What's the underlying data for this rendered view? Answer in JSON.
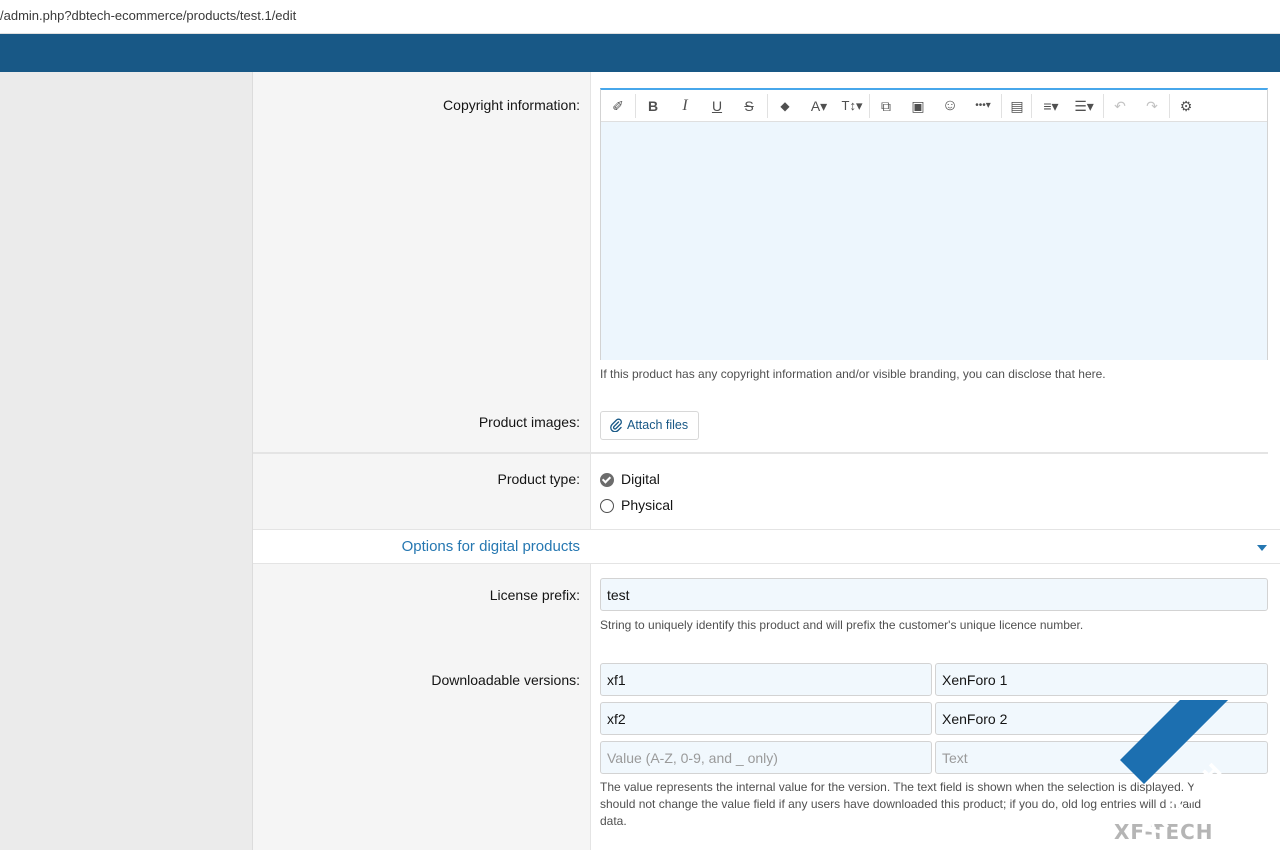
{
  "browser": {
    "url": "/admin.php?dbtech-ecommerce/products/test.1/edit"
  },
  "copyright": {
    "label": "Copyright information:",
    "hint": "If this product has any copyright information and/or visible branding, you can disclose that here.",
    "toolbar": {
      "remove_format": "✐",
      "bold": "B",
      "italic": "I",
      "underline": "U",
      "strike": "S",
      "color": "◆",
      "font_family": "A▾",
      "font_size": "T↕▾",
      "link": "⧉",
      "image": "▣",
      "smilie": "☺",
      "more": "•••▾",
      "media": "▤",
      "align": "≡▾",
      "list": "☰▾",
      "undo": "↶",
      "redo": "↷",
      "settings": "⚙"
    }
  },
  "images": {
    "label": "Product images:",
    "attach_label": "Attach files"
  },
  "product_type": {
    "label": "Product type:",
    "options": [
      {
        "label": "Digital",
        "selected": true
      },
      {
        "label": "Physical",
        "selected": false
      }
    ]
  },
  "digital_section": {
    "title": "Options for digital products"
  },
  "license": {
    "label": "License prefix:",
    "value": "test",
    "hint": "String to uniquely identify this product and will prefix the customer's unique licence number."
  },
  "versions": {
    "label": "Downloadable versions:",
    "rows": [
      {
        "value": "xf1",
        "text": "XenForo 1"
      },
      {
        "value": "xf2",
        "text": "XenForo 2"
      }
    ],
    "value_placeholder": "Value (A-Z, 0-9, and _ only)",
    "text_placeholder": "Text",
    "hint_lines": [
      "The value represents the internal value for the version. The text field is shown when the selection is displayed. Y",
      "should not change the value field if any users have downloaded this product; if you do, old log entries will d    nvalid",
      "data."
    ]
  },
  "watermark": {
    "text": "XF-TECH",
    "shadow": "XF-TECH"
  },
  "colors": {
    "header": "#185886",
    "accent": "#47a7eb",
    "link": "#2577b1",
    "input_bg": "#f1f8fd"
  }
}
